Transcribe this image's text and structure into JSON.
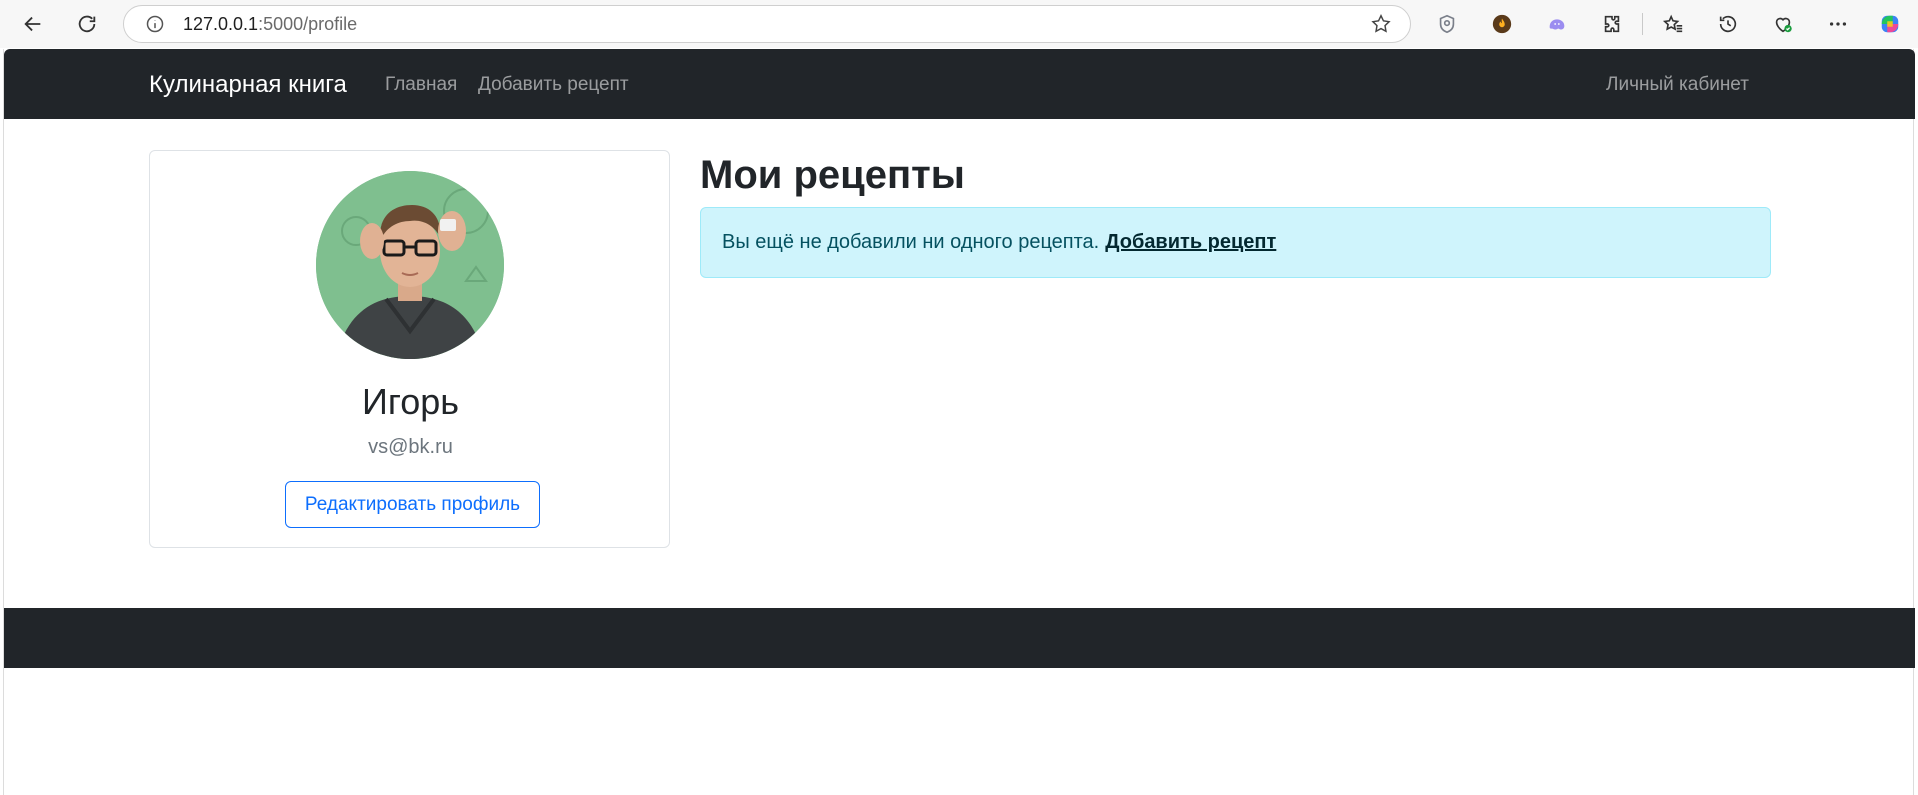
{
  "browser": {
    "url_host": "127.0.0.1",
    "url_path": ":5000/profile"
  },
  "navbar": {
    "brand": "Кулинарная книга",
    "links": [
      "Главная",
      "Добавить рецепт"
    ],
    "right_link": "Личный кабинет"
  },
  "profile": {
    "name": "Игорь",
    "email": "vs@bk.ru",
    "edit_button": "Редактировать профиль"
  },
  "recipes": {
    "title": "Мои рецепты",
    "empty_message": "Вы ещё не добавили ни одного рецепта.",
    "add_link": "Добавить рецепт"
  },
  "colors": {
    "navbar_bg": "#212529",
    "primary": "#0d6efd",
    "alert_bg": "#cff4fc",
    "alert_text": "#055160"
  }
}
